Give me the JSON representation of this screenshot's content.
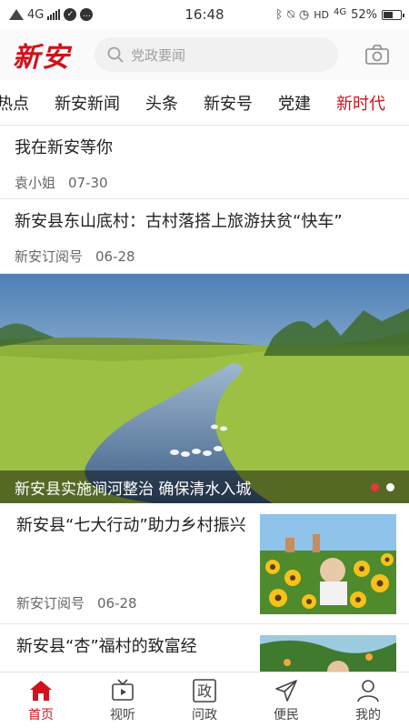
{
  "status_bar": {
    "network": "4G",
    "time": "16:48",
    "hd": "HD",
    "network2": "4G",
    "battery": "52%"
  },
  "header": {
    "logo": "新安",
    "search_placeholder": "党政要闻"
  },
  "tabs": [
    "热点",
    "新安新闻",
    "头条",
    "新安号",
    "党建",
    "新时代"
  ],
  "active_tab": "新时代",
  "feed": {
    "item1": {
      "title": "我在新安等你",
      "source": "袁小姐",
      "date": "07-30"
    },
    "item2": {
      "title": "新安县东山底村：古村落搭上旅游扶贫“快车”",
      "source": "新安订阅号",
      "date": "06-28"
    },
    "hero": {
      "caption": "新安县实施涧河整治 确保清水入城",
      "slides": 2,
      "active_slide": 1
    },
    "item3": {
      "title": "新安县“七大行动”助力乡村振兴",
      "source": "新安订阅号",
      "date": "06-28"
    },
    "item4": {
      "title": "新安县“杏”福村的致富经"
    }
  },
  "bottom_nav": {
    "home": "首页",
    "video": "视听",
    "ask": "问政",
    "service": "便民",
    "mine": "我的",
    "ask_glyph": "政"
  },
  "colors": {
    "accent": "#d0121b"
  }
}
